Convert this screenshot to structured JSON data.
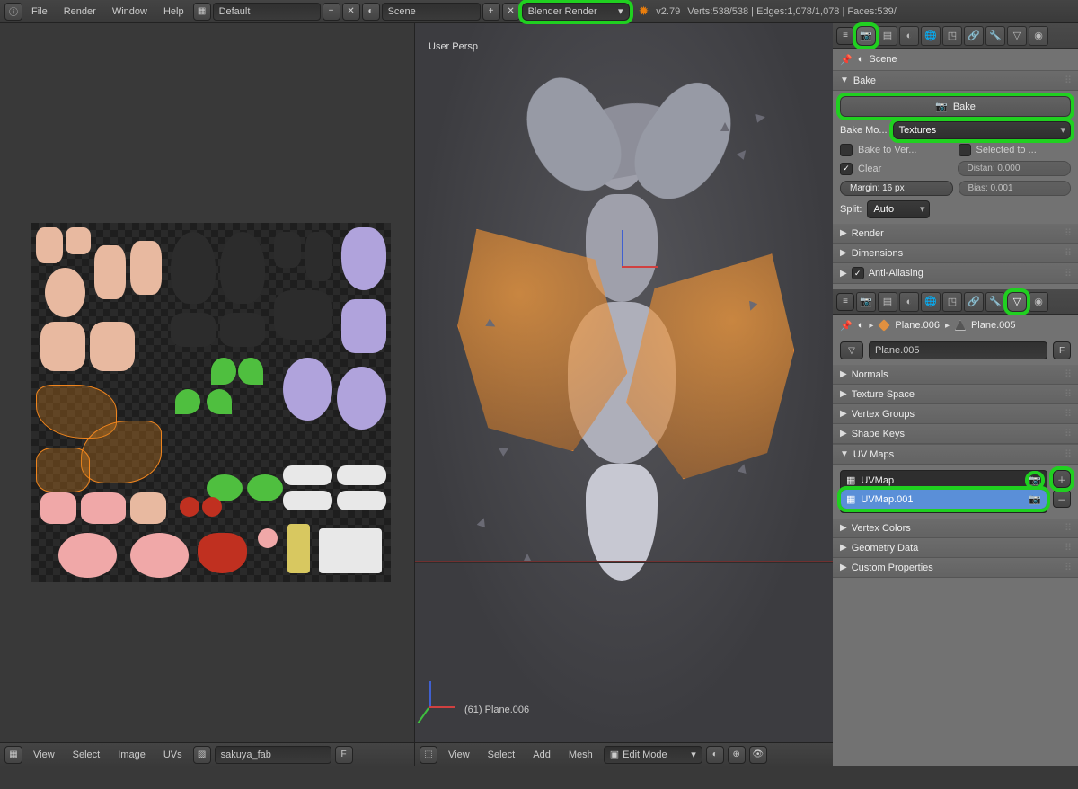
{
  "top_menu": {
    "items": [
      "File",
      "Render",
      "Window",
      "Help"
    ],
    "layout": "Default",
    "scene": "Scene",
    "engine": "Blender Render",
    "version": "v2.79",
    "stats": "Verts:538/538 | Edges:1,078/1,078 | Faces:539/"
  },
  "uv_editor": {
    "footer": {
      "view": "View",
      "select": "Select",
      "image": "Image",
      "uvs": "UVs",
      "image_name": "sakuya_fab",
      "fake_user": "F"
    }
  },
  "viewport": {
    "label": "User Persp",
    "object_label": "(61) Plane.006",
    "footer": {
      "view": "View",
      "select": "Select",
      "add": "Add",
      "mesh": "Mesh",
      "mode": "Edit Mode"
    }
  },
  "render_props": {
    "breadcrumb": "Scene",
    "bake_panel": "Bake",
    "bake_button": "Bake",
    "bake_mode_label": "Bake Mo...",
    "bake_mode_value": "Textures",
    "bake_to_vertex": "Bake to Ver...",
    "selected_to": "Selected to ...",
    "clear": "Clear",
    "distance": "Distan: 0.000",
    "margin": "Margin: 16 px",
    "bias": "Bias:    0.001",
    "split_label": "Split:",
    "split_value": "Auto",
    "panels": [
      "Render",
      "Dimensions",
      "Anti-Aliasing"
    ]
  },
  "data_props": {
    "breadcrumb_obj": "Plane.006",
    "breadcrumb_data": "Plane.005",
    "mesh_name": "Plane.005",
    "fake_user": "F",
    "panels_top": [
      "Normals",
      "Texture Space",
      "Vertex Groups",
      "Shape Keys"
    ],
    "uv_maps_panel": "UV Maps",
    "uv_maps": [
      "UVMap",
      "UVMap.001"
    ],
    "panels_bottom": [
      "Vertex Colors",
      "Geometry Data",
      "Custom Properties"
    ]
  }
}
